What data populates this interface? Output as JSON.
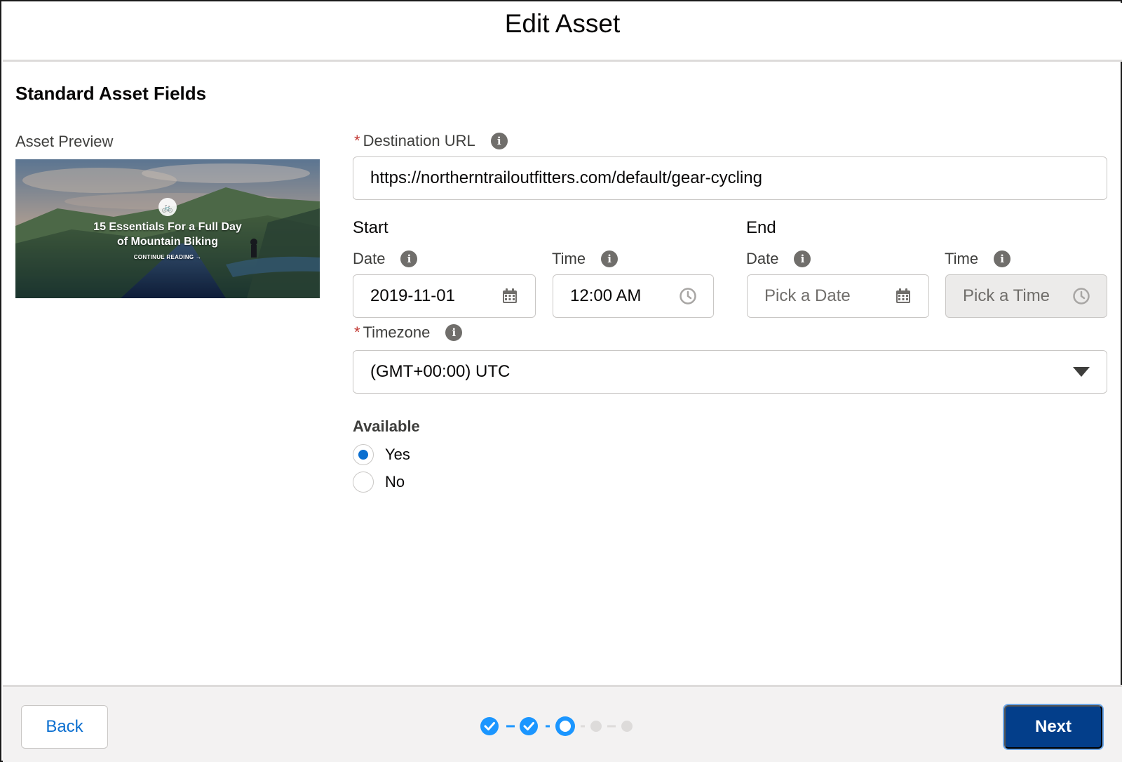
{
  "modal": {
    "title": "Edit Asset"
  },
  "section": {
    "title": "Standard Asset Fields"
  },
  "preview": {
    "label": "Asset Preview",
    "headline_line1": "15 Essentials For a Full Day",
    "headline_line2": "of Mountain Biking",
    "cta": "CONTINUE READING →"
  },
  "destination_url": {
    "label": "Destination URL",
    "required_mark": "*",
    "value": "https://northerntrailoutfitters.com/default/gear-cycling"
  },
  "start": {
    "label": "Start",
    "date_label": "Date",
    "date_value": "2019-11-01",
    "time_label": "Time",
    "time_value": "12:00 AM"
  },
  "end": {
    "label": "End",
    "date_label": "Date",
    "date_placeholder": "Pick a Date",
    "time_label": "Time",
    "time_placeholder": "Pick a Time"
  },
  "timezone": {
    "label": "Timezone",
    "required_mark": "*",
    "value": "(GMT+00:00) UTC"
  },
  "available": {
    "label": "Available",
    "options": [
      {
        "label": "Yes",
        "checked": true
      },
      {
        "label": "No",
        "checked": false
      }
    ]
  },
  "footer": {
    "back_label": "Back",
    "next_label": "Next",
    "progress": {
      "total_steps": 5,
      "completed_steps": 2,
      "current_step": 3
    }
  },
  "colors": {
    "brand": "#033e8a",
    "link": "#0b6fd0",
    "required": "#c23934",
    "progress_active": "#1b96ff"
  }
}
